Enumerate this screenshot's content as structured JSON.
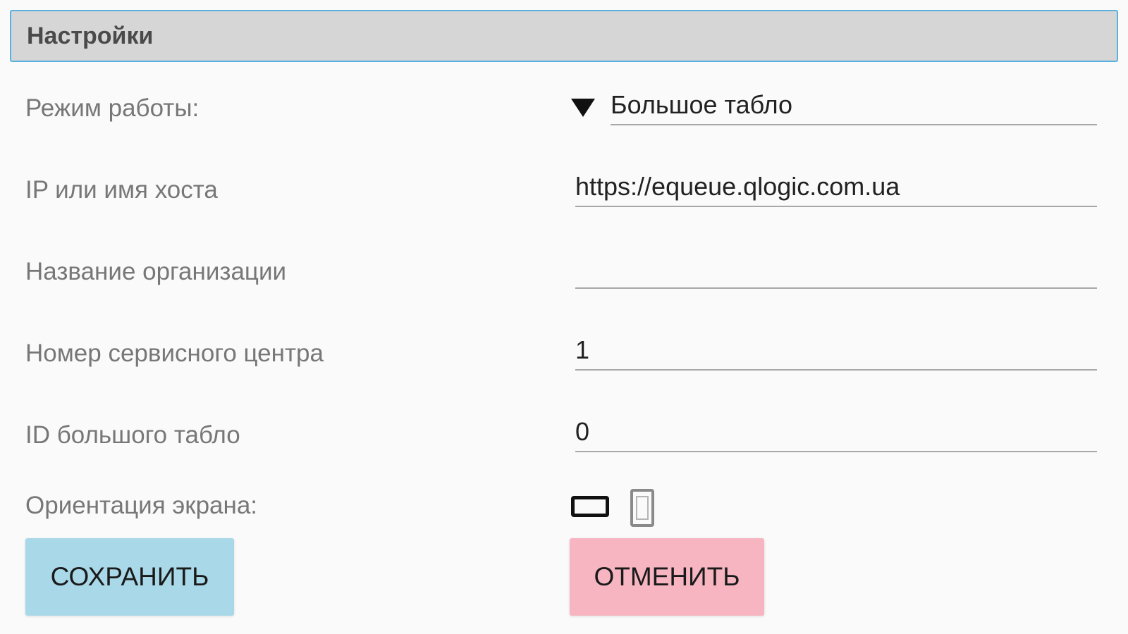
{
  "header": {
    "title": "Настройки"
  },
  "form": {
    "mode": {
      "label": "Режим работы:",
      "selected": "Большое табло"
    },
    "host": {
      "label": "IP или имя хоста",
      "value": "https://equeue.qlogic.com.ua"
    },
    "org": {
      "label": "Название организации",
      "value": ""
    },
    "service_center": {
      "label": "Номер сервисного центра",
      "value": "1"
    },
    "board_id": {
      "label": "ID большого табло",
      "value": "0"
    },
    "orientation": {
      "label": "Ориентация экрана:",
      "options": [
        "landscape-icon",
        "portrait-icon"
      ],
      "selected": "landscape"
    }
  },
  "buttons": {
    "save": "СОХРАНИТЬ",
    "cancel": "ОТМЕНИТЬ"
  },
  "colors": {
    "header_bg": "#d6d6d6",
    "header_border": "#5ab1e0",
    "save_bg": "#a9d8e8",
    "cancel_bg": "#f7b5c1"
  }
}
